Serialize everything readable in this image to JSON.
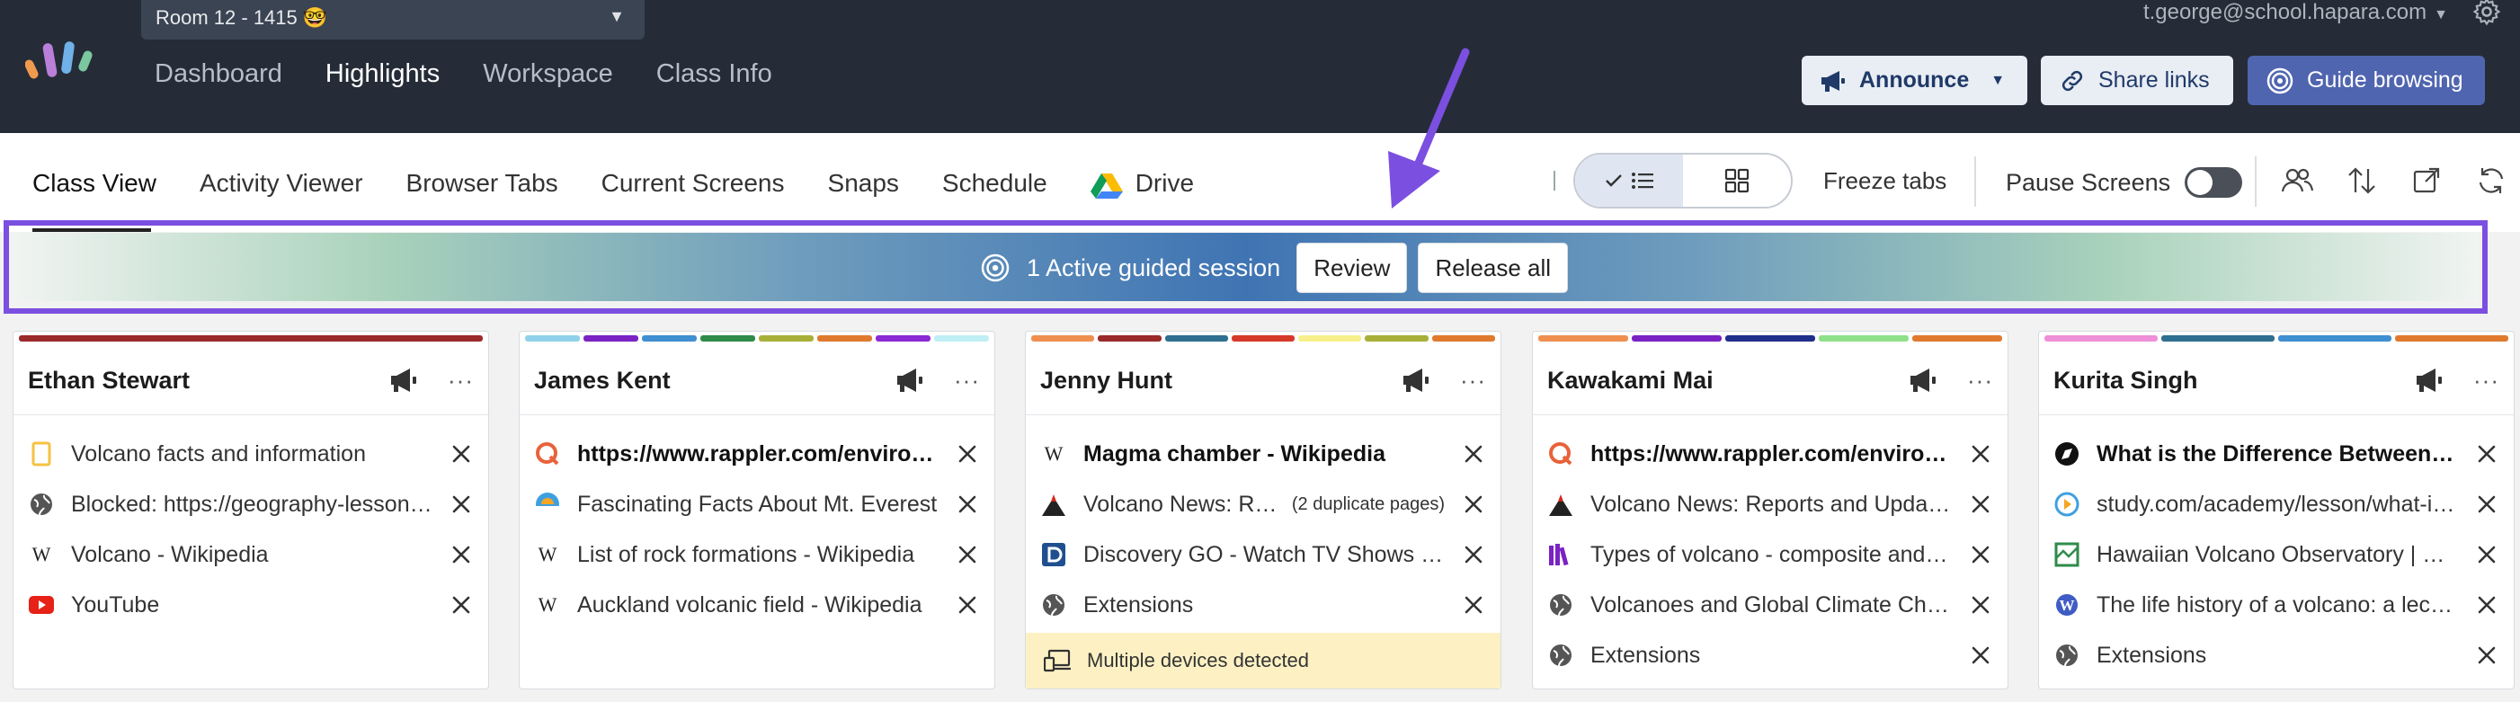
{
  "topbar": {
    "room": "Room 12 - 1415 🤓",
    "nav": [
      "Dashboard",
      "Highlights",
      "Workspace",
      "Class Info"
    ],
    "active_nav": "Highlights",
    "user": "t.george@school.hapara.com",
    "announce": "Announce",
    "share": "Share links",
    "guide": "Guide browsing",
    "colors": {
      "bg": "#252c37",
      "guide": "#5065b0",
      "highlight": "#7b4fe0"
    }
  },
  "subbar": {
    "tabs": [
      "Class View",
      "Activity Viewer",
      "Browser Tabs",
      "Current Screens",
      "Snaps",
      "Schedule"
    ],
    "drive": "Drive",
    "freeze": "Freeze tabs",
    "pause": "Pause Screens"
  },
  "banner": {
    "text": "1 Active guided session",
    "review": "Review",
    "release": "Release all"
  },
  "cards": [
    {
      "name": "Ethan Stewart",
      "colors": [
        "#9b2a2a"
      ],
      "rows": [
        {
          "icon": "bookmark-icon",
          "text": "Volcano facts and information",
          "bold": false
        },
        {
          "icon": "globe-icon",
          "text": "Blocked: https://geography-lessons.com",
          "bold": false
        },
        {
          "icon": "wikipedia-icon",
          "text": "Volcano - Wikipedia",
          "bold": false
        },
        {
          "icon": "youtube-icon",
          "text": "YouTube",
          "bold": false
        }
      ]
    },
    {
      "name": "James Kent",
      "colors": [
        "#8fd1ea",
        "#7a22c4",
        "#3f8fd1",
        "#2e8b4a",
        "#a8b03a",
        "#e07a2f",
        "#8a2ad4",
        "#bfeff4"
      ],
      "rows": [
        {
          "icon": "rappler-icon",
          "text": "https://www.rappler.com/environment",
          "bold": true
        },
        {
          "icon": "sunset-icon",
          "text": "Fascinating Facts About Mt. Everest",
          "bold": false
        },
        {
          "icon": "wikipedia-icon",
          "text": "List of rock formations - Wikipedia",
          "bold": false
        },
        {
          "icon": "wikipedia-icon",
          "text": "Auckland volcanic field - Wikipedia",
          "bold": false
        }
      ]
    },
    {
      "name": "Jenny Hunt",
      "colors": [
        "#ef9050",
        "#9b2a2a",
        "#2f6f8f",
        "#d63a2a",
        "#f7f08a",
        "#a8b03a",
        "#e07a2f"
      ],
      "rows": [
        {
          "icon": "wikipedia-icon",
          "text": "Magma chamber - Wikipedia",
          "bold": true
        },
        {
          "icon": "volcano-icon",
          "text": "Volcano News: Reports",
          "bold": false,
          "dup": "(2 duplicate pages)"
        },
        {
          "icon": "discovery-icon",
          "text": "Discovery GO - Watch TV Shows Online",
          "bold": false
        },
        {
          "icon": "globe-icon",
          "text": "Extensions",
          "bold": false
        }
      ],
      "warning": "Multiple devices detected"
    },
    {
      "name": "Kawakami Mai",
      "colors": [
        "#ef9050",
        "#7a22c4",
        "#1f2f8a",
        "#8fe08a",
        "#e07a2f"
      ],
      "rows": [
        {
          "icon": "rappler-icon",
          "text": "https://www.rappler.com/environment",
          "bold": true
        },
        {
          "icon": "volcano-icon",
          "text": "Volcano News: Reports and Updates",
          "bold": false
        },
        {
          "icon": "library-icon",
          "text": "Types of volcano - composite and shield",
          "bold": false
        },
        {
          "icon": "globe-icon",
          "text": "Volcanoes and Global Climate Change",
          "bold": false
        },
        {
          "icon": "globe-icon",
          "text": "Extensions",
          "bold": false
        }
      ]
    },
    {
      "name": "Kurita Singh",
      "colors": [
        "#ef8fd8",
        "#2f6f8f",
        "#3f8fd1",
        "#e07a2f"
      ],
      "rows": [
        {
          "icon": "compass-icon",
          "text": "What is the Difference Between Magma",
          "bold": true
        },
        {
          "icon": "studycom-icon",
          "text": "study.com/academy/lesson/what-is-magma",
          "bold": false
        },
        {
          "icon": "map-icon",
          "text": "Hawaiian Volcano Observatory | USGS",
          "bold": false
        },
        {
          "icon": "wordpress-icon",
          "text": "The life history of a volcano: a lecture",
          "bold": false
        },
        {
          "icon": "globe-icon",
          "text": "Extensions",
          "bold": false
        }
      ]
    }
  ]
}
